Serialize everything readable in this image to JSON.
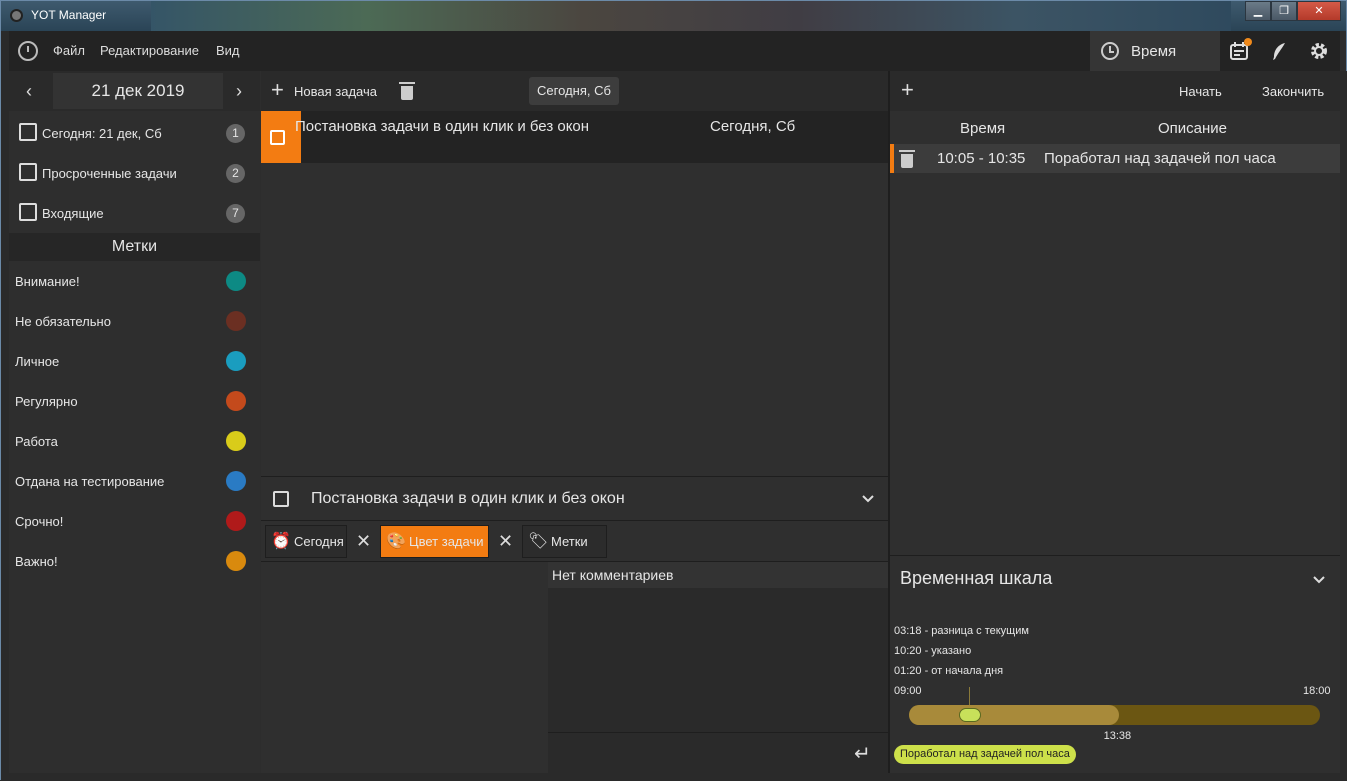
{
  "window": {
    "title": "YOT Manager",
    "minimize": "▁",
    "maximize": "❐",
    "close": "✕"
  },
  "menu": {
    "file": "Файл",
    "edit": "Редактирование",
    "view": "Вид",
    "time_tab": "Время"
  },
  "left": {
    "date": "21 дек 2019",
    "prev": "‹",
    "next": "›",
    "nav": [
      {
        "label": "Сегодня: 21 дек, Сб",
        "count": "1",
        "icon": "calendar-today-icon"
      },
      {
        "label": "Просроченные задачи",
        "count": "2",
        "icon": "calendar-overdue-icon"
      },
      {
        "label": "Входящие",
        "count": "7",
        "icon": "inbox-icon"
      }
    ],
    "labels_title": "Метки",
    "tags": [
      {
        "label": "Внимание!",
        "color": "#0d8a84"
      },
      {
        "label": "Не обязательно",
        "color": "#6b2f22"
      },
      {
        "label": "Личное",
        "color": "#1a9dbf"
      },
      {
        "label": "Регулярно",
        "color": "#c44a1c"
      },
      {
        "label": "Работа",
        "color": "#d9cc1a"
      },
      {
        "label": "Отдана на тестирование",
        "color": "#2a7bc4"
      },
      {
        "label": "Срочно!",
        "color": "#b01a1a"
      },
      {
        "label": "Важно!",
        "color": "#d98a0e"
      }
    ]
  },
  "middle": {
    "new_task": "Новая задача",
    "today_button": "Сегодня, Сб",
    "task": {
      "title": "Постановка задачи в один клик и без окон",
      "date": "Сегодня, Сб"
    },
    "detail": {
      "title": "Постановка задачи в один клик и без окон",
      "chip_today": "Сегодня",
      "chip_color": "Цвет задачи",
      "chip_tags": "Метки",
      "no_comments": "Нет комментариев"
    }
  },
  "right": {
    "start": "Начать",
    "finish": "Закончить",
    "col_time": "Время",
    "col_desc": "Описание",
    "entries": [
      {
        "time": "10:05 - 10:35",
        "desc": "Поработал над задачей пол часа"
      }
    ],
    "timeline": {
      "title": "Временная шкала",
      "diff": "03:18 - разница с текущим",
      "specified": "10:20 - указано",
      "from_start": "01:20 - от начала дня",
      "start_label": "09:00",
      "end_label": "18:00",
      "now_label": "13:38",
      "progress_fraction": 0.51,
      "pill": "Поработал над задачей пол часа"
    }
  },
  "colors": {
    "accent": "#f37c12",
    "timeline_pill": "#cde04a"
  }
}
